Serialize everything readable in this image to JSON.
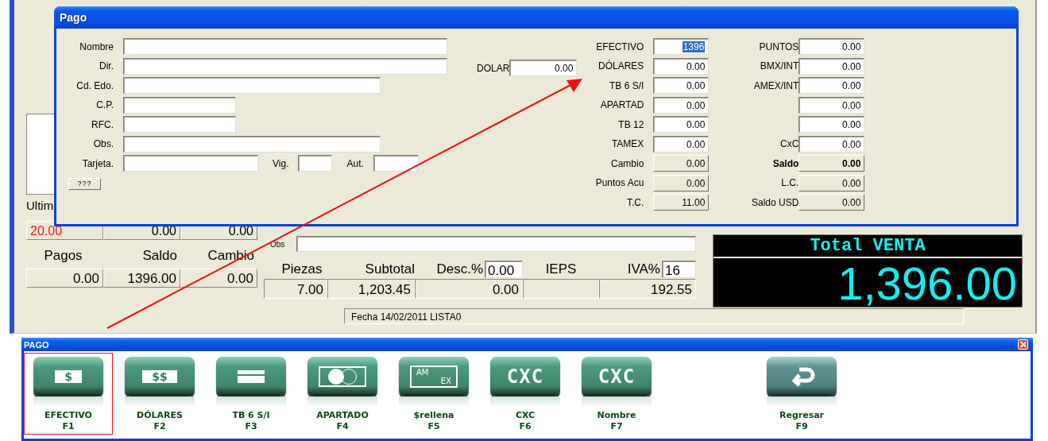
{
  "main_window": {
    "partial_label": "Ultim",
    "last_row": [
      {
        "text": "20.00",
        "highlight": true
      },
      {
        "text": "0.00",
        "highlight": false
      },
      {
        "text": "0.00",
        "highlight": false
      }
    ],
    "summary_labels": [
      "Pagos",
      "Saldo",
      "Cambio"
    ],
    "summary_values": [
      "0.00",
      "1396.00",
      "0.00"
    ],
    "obs_label": "Obs",
    "totals": [
      {
        "label": "Piezas",
        "value": "7.00"
      },
      {
        "label": "Subtotal",
        "value": "1,203.45"
      },
      {
        "label": "Desc.%",
        "input": "0.00",
        "value": "0.00"
      },
      {
        "label": "IEPS"
      },
      {
        "label": "IVA%",
        "input": "16",
        "value": "192.55"
      }
    ],
    "total_panel": {
      "title": "Total VENTA",
      "amount": "1,396.00"
    },
    "status": "Fecha 14/02/2011 LISTA0"
  },
  "dialog": {
    "title": "Pago",
    "customer_fields": [
      {
        "label": "Nombre",
        "kind": "long"
      },
      {
        "label": "Dir.",
        "kind": "long"
      },
      {
        "label": "Cd. Edo.",
        "kind": "medium"
      },
      {
        "label": "C.P.",
        "kind": "short"
      },
      {
        "label": "RFC.",
        "kind": "short"
      },
      {
        "label": "Obs.",
        "kind": "medium"
      },
      {
        "label": "Tarjeta.",
        "kind": "card",
        "extra": [
          {
            "label": "Vig.",
            "kind": "tiny"
          },
          {
            "label": "Aut.",
            "kind": "small"
          }
        ]
      }
    ],
    "help_button": "???",
    "dolar": {
      "label": "DOLAR",
      "value": "0.00"
    },
    "amounts_left": [
      {
        "label": "EFECTIVO",
        "value": "1396",
        "readonly": false,
        "selected": true,
        "emphasis": false
      },
      {
        "label": "DÓLARES",
        "value": "0.00",
        "readonly": false,
        "selected": false,
        "emphasis": false
      },
      {
        "label": "TB 6 S/I",
        "value": "0.00",
        "readonly": false,
        "selected": false,
        "emphasis": false
      },
      {
        "label": "APARTAD",
        "value": "0.00",
        "readonly": false,
        "selected": false,
        "emphasis": false
      },
      {
        "label": "TB 12",
        "value": "0.00",
        "readonly": false,
        "selected": false,
        "emphasis": false
      },
      {
        "label": "TAMEX",
        "value": "0.00",
        "readonly": false,
        "selected": false,
        "emphasis": false
      },
      {
        "label": "Cambio",
        "value": "0.00",
        "readonly": true,
        "selected": false,
        "emphasis": false
      },
      {
        "label": "Puntos Acu",
        "value": "0.00",
        "readonly": true,
        "selected": false,
        "emphasis": false
      },
      {
        "label": "T.C.",
        "value": "11.00",
        "readonly": true,
        "selected": false,
        "emphasis": false
      }
    ],
    "amounts_right": [
      {
        "label": "PUNTOS",
        "value": "0.00",
        "readonly": false,
        "selected": false,
        "emphasis": false
      },
      {
        "label": "BMX/INT",
        "value": "0.00",
        "readonly": false,
        "selected": false,
        "emphasis": false
      },
      {
        "label": "AMEX/INT",
        "value": "0.00",
        "readonly": false,
        "selected": false,
        "emphasis": false
      },
      {
        "value": "0.00",
        "readonly": false,
        "selected": false,
        "emphasis": false
      },
      {
        "value": "0.00",
        "readonly": false,
        "selected": false,
        "emphasis": false
      },
      {
        "label": "CxC",
        "value": "0.00",
        "readonly": false,
        "selected": false,
        "emphasis": false
      },
      {
        "label": "Saldo",
        "value": "0.00",
        "readonly": true,
        "selected": false,
        "emphasis": true
      },
      {
        "label": "L.C.",
        "value": "0.00",
        "readonly": true,
        "selected": false,
        "emphasis": false
      },
      {
        "label": "Saldo USD",
        "value": "0.00",
        "readonly": true,
        "selected": false,
        "emphasis": false
      }
    ]
  },
  "payment_panel": {
    "title": "PAGO",
    "buttons": [
      {
        "kind": "cash",
        "icon_text": [
          "$"
        ],
        "label": "EFECTIVO",
        "key": "F1",
        "highlighted": true
      },
      {
        "kind": "dollars",
        "icon_text": [
          "$$"
        ],
        "label": "DÓLARES",
        "key": "F2",
        "highlighted": false
      },
      {
        "kind": "card",
        "label": "TB 6 S/I",
        "key": "F3",
        "highlighted": false
      },
      {
        "kind": "layaway",
        "label": "APARTADO",
        "key": "F4",
        "highlighted": false
      },
      {
        "kind": "amex",
        "icon_text": [
          "AM",
          "EX"
        ],
        "label": "$rellena",
        "key": "F5",
        "highlighted": false
      },
      {
        "kind": "text",
        "icon_text": [
          "CXC"
        ],
        "label": "CXC",
        "key": "F6",
        "highlighted": false
      },
      {
        "kind": "text",
        "icon_text": [
          "CXC"
        ],
        "label": "Nombre",
        "key": "F7",
        "highlighted": false
      },
      {
        "kind": "return",
        "label": "Regresar",
        "key": "F9",
        "highlighted": false
      }
    ]
  }
}
